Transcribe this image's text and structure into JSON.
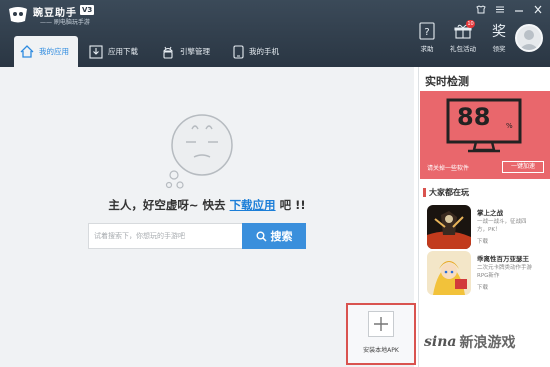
{
  "app": {
    "name": "豌豆助手",
    "version": "V3",
    "slogan": "—— 刷电脑玩手游"
  },
  "nav": {
    "items": [
      {
        "label": "我的应用",
        "icon": "home-icon",
        "active": true
      },
      {
        "label": "应用下载",
        "icon": "download-icon",
        "active": false
      },
      {
        "label": "引擎管理",
        "icon": "android-icon",
        "active": false
      },
      {
        "label": "我的手机",
        "icon": "phone-icon",
        "active": false
      }
    ]
  },
  "tools": {
    "help": "求助",
    "gift": "礼包活动",
    "gift_badge": "10",
    "reward": "领奖",
    "reward_icon_text": "奖"
  },
  "main": {
    "empty_prefix": "主人，好空虚呀~ 快去",
    "empty_link": "下载应用",
    "empty_suffix": "吧 !!",
    "search_placeholder": "试着搜索下，你想玩的手游吧",
    "search_button": "搜索",
    "install_apk": "安装本地APK"
  },
  "realtime": {
    "title": "实时检测",
    "value": "88",
    "unit": "%",
    "status": "请关掉一些软件",
    "accelerate": "一键加速"
  },
  "popular": {
    "title": "大家都在玩",
    "games": [
      {
        "name": "掌上之战",
        "desc": "一战一战斗，征战四",
        "desc2": "方，PK！",
        "cta": "下载"
      },
      {
        "name": "乖离性百万亚瑟王",
        "desc": "二次元卡牌类动作手游",
        "desc2": "RPG新作",
        "cta": "下载"
      }
    ]
  },
  "watermark": {
    "sina": "sina",
    "text": "新浪游戏"
  },
  "colors": {
    "topbar": "#2f3b48",
    "accent": "#2d8be0",
    "alert": "#e9676c",
    "highlight_border": "#d9534f"
  }
}
